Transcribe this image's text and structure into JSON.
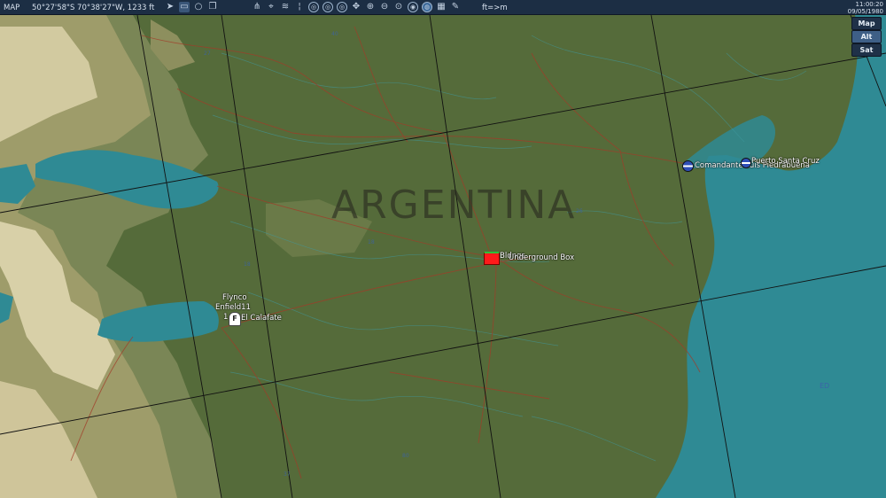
{
  "topbar": {
    "mode_label": "MAP",
    "coordinates": "50°27'58\"S 70°38'27\"W, 1233 ft",
    "units_label": "ft=>m",
    "time": "11:00:20",
    "date": "09/05/1980"
  },
  "tools": [
    "nav-arrow-icon",
    "tag-icon",
    "circle-icon",
    "copy-icon",
    "network-icon",
    "target-icon",
    "wifi-icon",
    "thermometer-icon",
    "range-ring-icon",
    "range-ring-2-icon",
    "range-ring-3-icon",
    "move-icon",
    "zoom-in-icon",
    "zoom-out-icon",
    "zoom-area-icon",
    "radar-icon",
    "globe-icon",
    "grid-icon",
    "pencil-icon"
  ],
  "map_types": [
    {
      "label": "Map",
      "active": false
    },
    {
      "label": "Alt",
      "active": true
    },
    {
      "label": "Sat",
      "active": false
    }
  ],
  "map": {
    "country_label": "ARGENTINA",
    "units": {
      "flynco": "Flynco",
      "enfield": "Enfield11",
      "calafate_prefix": "1",
      "calafate": "El Calafate",
      "bunker_line1": "Bldngs",
      "bunker_line2": "Underground Box",
      "comandante": "Comandante Luis Piedrabuena",
      "puerto": "Puerto Santa Cruz"
    },
    "grid_labels": [
      "ED"
    ],
    "colors": {
      "land": "#556b3a",
      "water": "#2f8a94",
      "roads": "#a23b28",
      "contours": "#3f9aa0",
      "gridlines": "#111111",
      "toolbar": "#1c2e44"
    }
  }
}
